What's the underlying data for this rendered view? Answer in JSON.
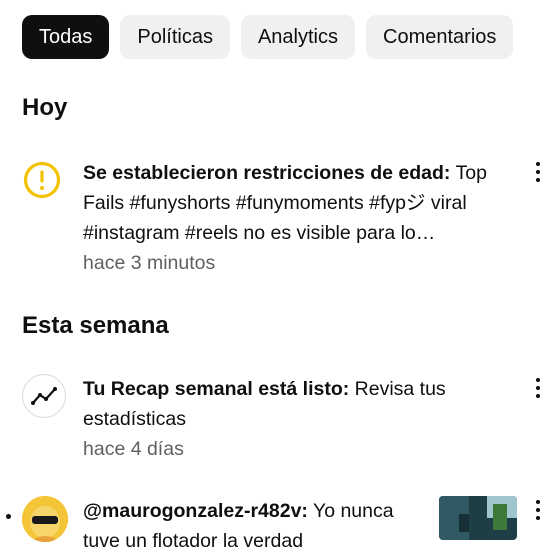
{
  "filters": {
    "chips": [
      {
        "label": "Todas",
        "active": true
      },
      {
        "label": "Políticas",
        "active": false
      },
      {
        "label": "Analytics",
        "active": false
      },
      {
        "label": "Comentarios",
        "active": false
      }
    ]
  },
  "sections": {
    "today": {
      "title": "Hoy"
    },
    "week": {
      "title": "Esta semana"
    }
  },
  "notifications": [
    {
      "icon": "warning-circle-icon",
      "title_bold": "Se establecieron restricciones de edad:",
      "body": " Top Fails #funyshorts #funymoments #fypジ viral #instagram #reels no es visible para lo…",
      "time": "hace 3 minutos",
      "accent": "#f2c200"
    },
    {
      "icon": "trending-line-icon",
      "title_bold": "Tu Recap semanal está listo:",
      "body": " Revisa tus estadísticas",
      "time": "hace 4 días"
    },
    {
      "icon": "user-avatar",
      "title_bold": "@maurogonzalez-r482v:",
      "body": " Yo nunca tuve un flotador la verdad",
      "unread": true
    }
  ],
  "menu_icon": "more-vert-icon"
}
